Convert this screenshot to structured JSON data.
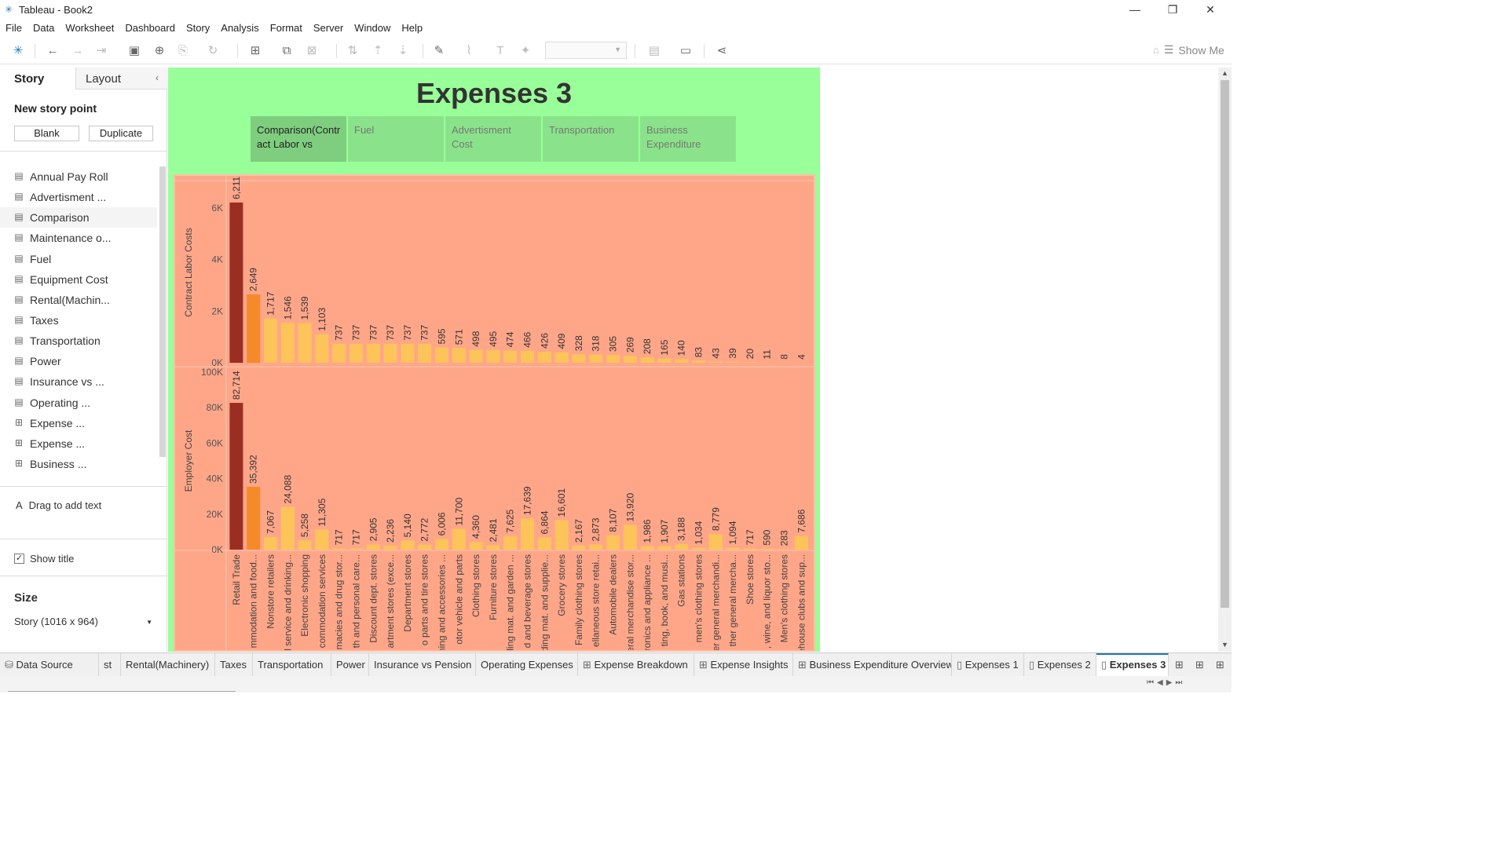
{
  "window": {
    "title": "Tableau - Book2",
    "minimize": "—",
    "maximize": "❐",
    "close": "✕"
  },
  "menu": [
    "File",
    "Data",
    "Worksheet",
    "Dashboard",
    "Story",
    "Analysis",
    "Format",
    "Server",
    "Window",
    "Help"
  ],
  "toolbar": {
    "show_me": "Show Me"
  },
  "sidebar": {
    "tabs": {
      "story": "Story",
      "layout": "Layout"
    },
    "new_story_point": "New story point",
    "blank_button": "Blank",
    "duplicate_button": "Duplicate",
    "sheets": [
      {
        "label": "Annual Pay Roll",
        "icon": "worksheet-icon"
      },
      {
        "label": "Advertisment ...",
        "icon": "worksheet-icon"
      },
      {
        "label": "Comparison",
        "icon": "worksheet-icon"
      },
      {
        "label": "Maintenance o...",
        "icon": "worksheet-icon"
      },
      {
        "label": "Fuel",
        "icon": "worksheet-icon"
      },
      {
        "label": "Equipment Cost",
        "icon": "worksheet-icon"
      },
      {
        "label": "Rental(Machin...",
        "icon": "worksheet-icon"
      },
      {
        "label": "Taxes",
        "icon": "worksheet-icon"
      },
      {
        "label": "Transportation",
        "icon": "worksheet-icon"
      },
      {
        "label": "Power",
        "icon": "worksheet-icon"
      },
      {
        "label": "Insurance vs ...",
        "icon": "worksheet-icon"
      },
      {
        "label": "Operating ...",
        "icon": "worksheet-icon"
      },
      {
        "label": "Expense ...",
        "icon": "dashboard-icon"
      },
      {
        "label": "Expense ...",
        "icon": "dashboard-icon"
      },
      {
        "label": "Business ...",
        "icon": "dashboard-icon"
      }
    ],
    "drag_text": "Drag to add text",
    "show_title": "Show title",
    "size_label": "Size",
    "size_value": "Story (1016 x 964)"
  },
  "story": {
    "title": "Expenses 3",
    "points": [
      "Comparison(Contr act Labor vs",
      "Fuel",
      "Advertisment Cost",
      "Transportation",
      "Business Expenditure"
    ]
  },
  "chart_data": {
    "type": "bar",
    "categories": [
      "Retail Trade",
      "mmodation and food...",
      "Nonstore retailers",
      "l service and drinking...",
      "Electronic shopping",
      "commodation services",
      "macies and drug stor...",
      "th and personal care...",
      "Discount dept. stores",
      "artment stores (exce...",
      "Department stores",
      "o parts and tire stores",
      "hing and accessories ...",
      "otor vehicle and parts",
      "Clothing stores",
      "Furniture stores",
      "ding mat. and garden ...",
      "d and beverage stores",
      "ding mat. and supplie...",
      "Grocery stores",
      "Family clothing stores",
      "ellaneous store retai...",
      "Automobile dealers",
      "eral merchandise stor...",
      "ronics and appliance ...",
      "ting, book, and musi...",
      "Gas stations",
      "men's clothing stores",
      "er general merchandi...",
      "ther general mercha...",
      "Shoe stores",
      ", wine, and liquor sto...",
      "Men's clothing stores",
      "ehouse clubs and sup..."
    ],
    "series": [
      {
        "name": "Contract Labor Costs",
        "values": [
          6211,
          2649,
          1717,
          1546,
          1539,
          1103,
          737,
          737,
          737,
          737,
          737,
          737,
          595,
          571,
          498,
          495,
          474,
          466,
          426,
          409,
          328,
          318,
          305,
          269,
          208,
          165,
          140,
          83,
          43,
          39,
          20,
          11,
          8,
          4
        ],
        "ylim": [
          0,
          7000
        ],
        "ticks": [
          "0K",
          "2K",
          "4K",
          "6K"
        ],
        "tick_values": [
          0,
          2000,
          4000,
          6000
        ]
      },
      {
        "name": "Employer Cost",
        "values": [
          82714,
          35392,
          7067,
          24088,
          5258,
          11305,
          717,
          717,
          2905,
          2236,
          5140,
          2772,
          6006,
          11700,
          4360,
          2481,
          7625,
          17639,
          6864,
          16601,
          2167,
          2873,
          8107,
          13920,
          1986,
          1907,
          3188,
          1034,
          8779,
          1094,
          717,
          590,
          283,
          7686
        ],
        "ylim": [
          0,
          100000
        ],
        "ticks": [
          "0K",
          "20K",
          "40K",
          "60K",
          "80K",
          "100K"
        ],
        "tick_values": [
          0,
          20000,
          40000,
          60000,
          80000,
          100000
        ]
      }
    ],
    "colors": {
      "low": "#fdc45a",
      "mid": "#f58a2a",
      "high": "#9a2e22",
      "background": "#ffa689"
    },
    "grid": false,
    "legend": "none"
  },
  "bottom_tabs": [
    {
      "label": "Data Source",
      "icon": "datasource-icon"
    },
    {
      "label": "st",
      "icon": ""
    },
    {
      "label": "Rental(Machinery)",
      "icon": ""
    },
    {
      "label": "Taxes",
      "icon": ""
    },
    {
      "label": "Transportation",
      "icon": ""
    },
    {
      "label": "Power",
      "icon": ""
    },
    {
      "label": "Insurance vs Pension",
      "icon": ""
    },
    {
      "label": "Operating Expenses",
      "icon": ""
    },
    {
      "label": "Expense Breakdown",
      "icon": "dashboard-icon"
    },
    {
      "label": "Expense Insights",
      "icon": "dashboard-icon"
    },
    {
      "label": "Business Expenditure Overview",
      "icon": "dashboard-icon"
    },
    {
      "label": "Expenses 1",
      "icon": "story-icon"
    },
    {
      "label": "Expenses 2",
      "icon": "story-icon"
    },
    {
      "label": "Expenses 3",
      "icon": "story-icon"
    }
  ]
}
